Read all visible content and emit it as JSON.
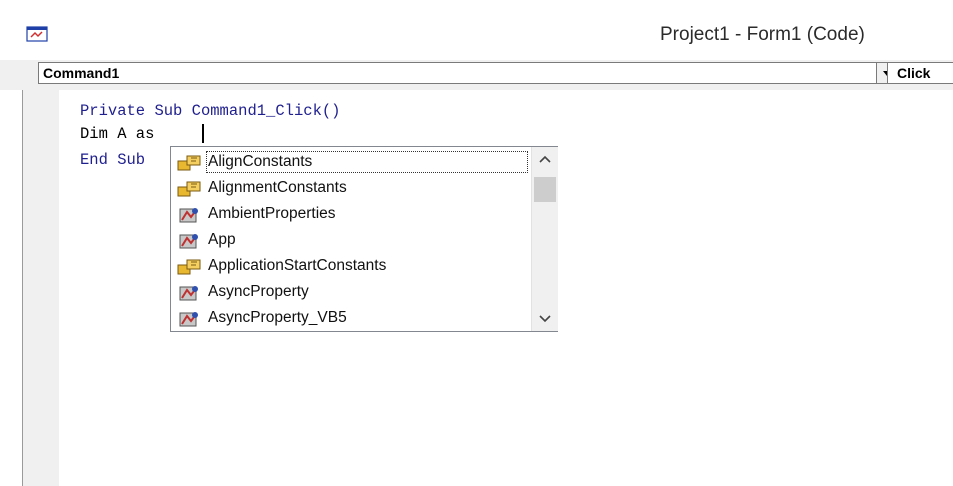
{
  "window": {
    "title": "Project1 - Form1 (Code)",
    "icon": "form-code-icon"
  },
  "toolbar": {
    "object_combo_value": "Command1",
    "procedure_combo_value": "Click",
    "dropdown_icon": "chevron-down-icon"
  },
  "code": {
    "line1_kw1": "Private",
    "line1_kw2": "Sub",
    "line1_rest": " Command1_Click()",
    "line2": "Dim A as ",
    "line3_kw": "End Sub"
  },
  "autocomplete": {
    "items": [
      {
        "label": "AlignConstants",
        "icon": "enum-icon",
        "selected": true
      },
      {
        "label": "AlignmentConstants",
        "icon": "enum-icon"
      },
      {
        "label": "AmbientProperties",
        "icon": "class-icon"
      },
      {
        "label": "App",
        "icon": "class-icon"
      },
      {
        "label": "ApplicationStartConstants",
        "icon": "enum-icon"
      },
      {
        "label": "AsyncProperty",
        "icon": "class-icon"
      },
      {
        "label": "AsyncProperty_VB5",
        "icon": "class-icon"
      }
    ]
  }
}
